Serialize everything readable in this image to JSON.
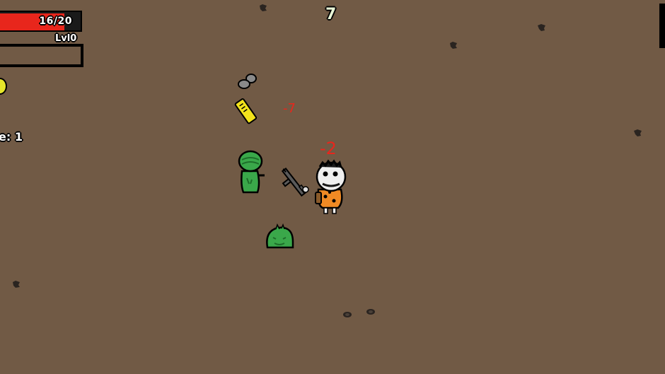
{
  "hud": {
    "hp_text": "16/20",
    "hp_fraction": 0.8,
    "level_text": "Lvl0",
    "xp_fraction": 0.0,
    "wave_text": "e: 1",
    "timer": "7"
  },
  "floaters": {
    "damage_1": "-7",
    "damage_2": "-2"
  },
  "colors": {
    "ground": "#715a45",
    "hp_red": "#e8261c",
    "alien_green": "#3aa84a",
    "coin_yellow": "#e6e62a"
  }
}
